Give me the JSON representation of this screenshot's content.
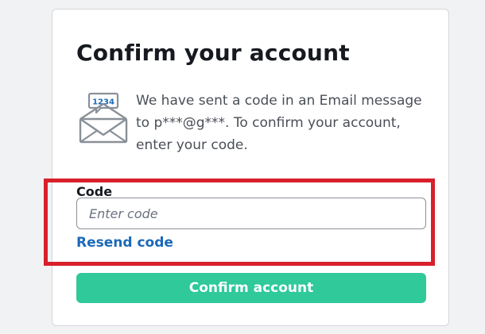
{
  "form": {
    "title": "Confirm your account",
    "message": "We have sent a code in an Email message to p***@g***. To confirm your account, enter your code.",
    "icon_code": "1234",
    "icon": "envelope-code-icon",
    "code_label": "Code",
    "code_placeholder": "Enter code",
    "code_value": "",
    "resend_label": "Resend code",
    "confirm_label": "Confirm account"
  },
  "colors": {
    "accent_button": "#2fc99a",
    "link": "#1b6ab8",
    "highlight": "#d8202b",
    "background": "#f1f2f4"
  }
}
